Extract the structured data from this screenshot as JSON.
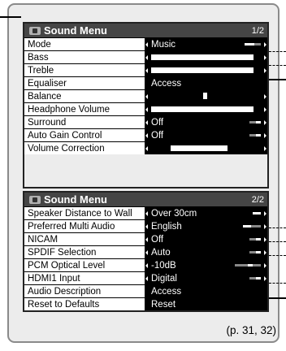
{
  "panel1": {
    "title": "Sound Menu",
    "page": "1/2",
    "rows": [
      {
        "label": "Mode",
        "value": "Music"
      },
      {
        "label": "Bass",
        "value": ""
      },
      {
        "label": "Treble",
        "value": ""
      },
      {
        "label": "Equaliser",
        "value": "Access"
      },
      {
        "label": "Balance",
        "value": ""
      },
      {
        "label": "Headphone Volume",
        "value": ""
      },
      {
        "label": "Surround",
        "value": "Off"
      },
      {
        "label": "Auto Gain Control",
        "value": "Off"
      },
      {
        "label": "Volume Correction",
        "value": ""
      }
    ]
  },
  "panel2": {
    "title": "Sound Menu",
    "page": "2/2",
    "rows": [
      {
        "label": "Speaker Distance to Wall",
        "value": "Over 30cm"
      },
      {
        "label": "Preferred Multi Audio",
        "value": "English"
      },
      {
        "label": "NICAM",
        "value": "Off"
      },
      {
        "label": "SPDIF Selection",
        "value": "Auto"
      },
      {
        "label": "PCM Optical Level",
        "value": "-10dB"
      },
      {
        "label": "HDMI1 Input",
        "value": "Digital"
      },
      {
        "label": "Audio Description",
        "value": "Access"
      },
      {
        "label": "Reset to Defaults",
        "value": "Reset"
      }
    ]
  },
  "page_reference": "(p. 31, 32)",
  "colors": {
    "frame_bg": "#ececec",
    "header_bg": "#454545",
    "value_bg": "#000000",
    "label_bg": "#ffffff"
  }
}
